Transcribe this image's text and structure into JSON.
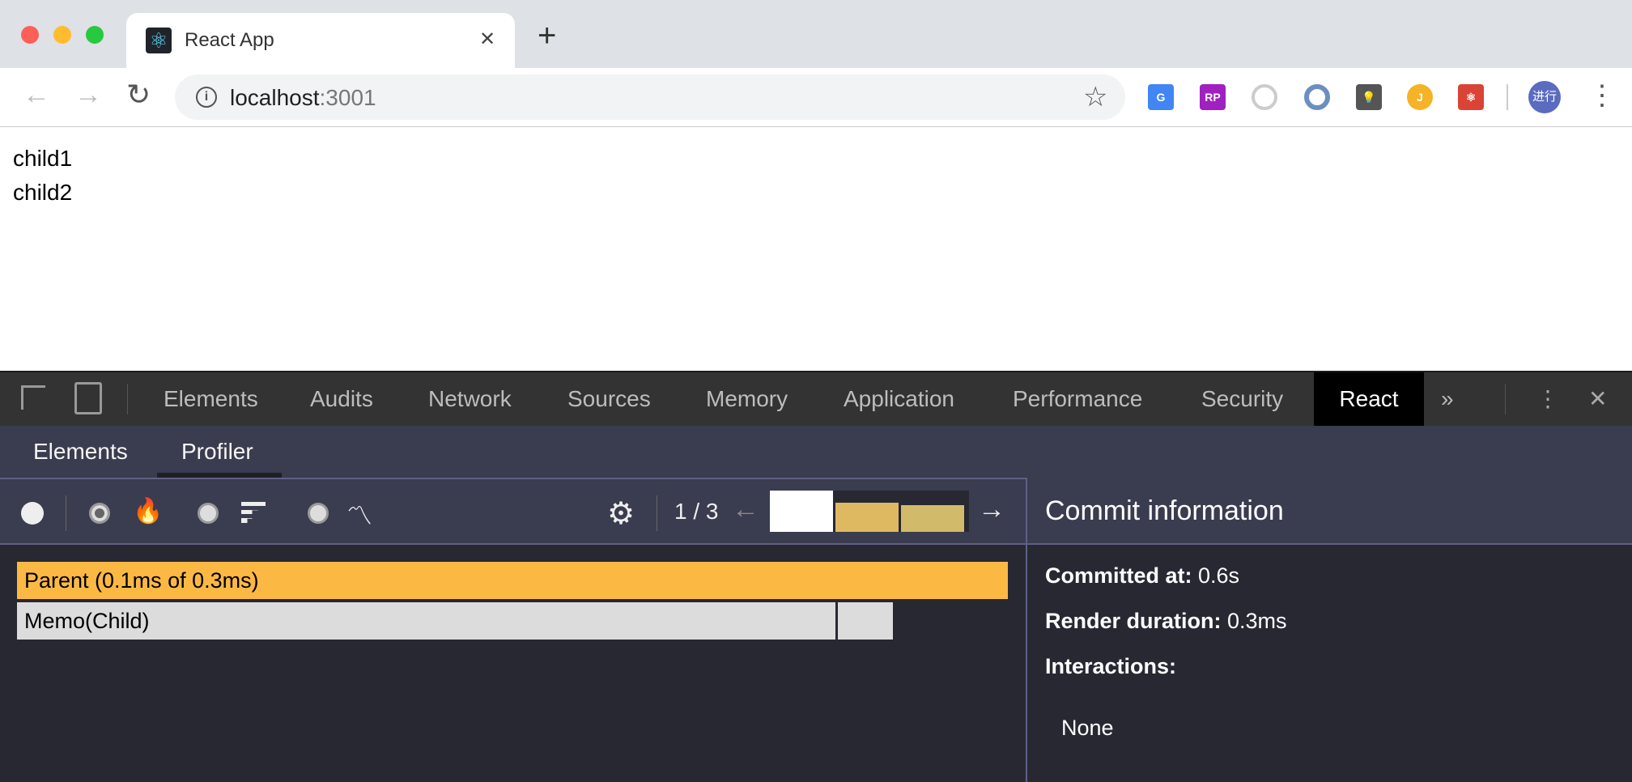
{
  "browser": {
    "tab_title": "React App",
    "url_host": "localhost",
    "url_port": ":3001",
    "new_tab": "+",
    "close_tab": "✕",
    "profile_avatar": "进行",
    "extensions": [
      "google-translate",
      "axure-rp",
      "ext-circle",
      "ext-ring",
      "ext-bulb",
      "ext-yellow-gear",
      "ext-react-dev"
    ]
  },
  "page": {
    "lines": [
      "child1",
      "child2"
    ]
  },
  "devtools": {
    "tabs": [
      "Elements",
      "Audits",
      "Network",
      "Sources",
      "Memory",
      "Application",
      "Performance",
      "Security",
      "React"
    ],
    "active_tab": "React",
    "overflow": "»",
    "close": "✕",
    "subtabs": [
      "Elements",
      "Profiler"
    ],
    "active_subtab": "Profiler",
    "profiler": {
      "commit_counter": "1 / 3",
      "commits": [
        {
          "duration_fraction": 1.0,
          "color": "#ffffff",
          "selected": true
        },
        {
          "duration_fraction": 0.7,
          "color": "#dfb961"
        },
        {
          "duration_fraction": 0.64,
          "color": "#d1ba6a"
        }
      ],
      "flame": [
        {
          "label": "Parent (0.1ms of 0.3ms)",
          "color": "#fbb944"
        },
        {
          "label": "Memo(Child)",
          "color": "#dcdcdc"
        }
      ],
      "commit_info": {
        "title": "Commit information",
        "committed_at_label": "Committed at:",
        "committed_at_value": " 0.6s",
        "render_duration_label": "Render duration:",
        "render_duration_value": " 0.3ms",
        "interactions_label": "Interactions:",
        "interactions_value": "None"
      }
    }
  }
}
